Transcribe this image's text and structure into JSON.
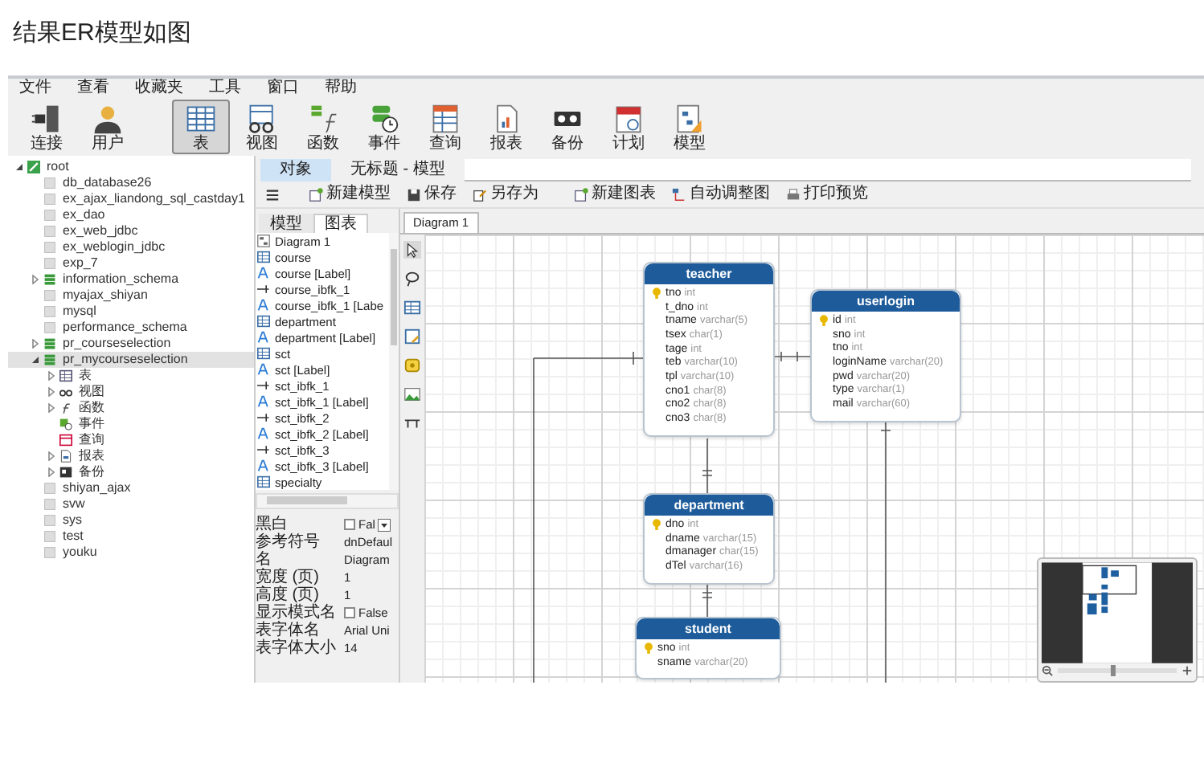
{
  "heading": "结果ER模型如图",
  "menu": [
    "文件",
    "查看",
    "收藏夹",
    "工具",
    "窗口",
    "帮助"
  ],
  "toolbar": [
    {
      "label": "连接",
      "kind": "plug",
      "selected": false
    },
    {
      "label": "用户",
      "kind": "user",
      "selected": false
    },
    {
      "label": "表",
      "kind": "table",
      "selected": true
    },
    {
      "label": "视图",
      "kind": "view",
      "selected": false
    },
    {
      "label": "函数",
      "kind": "function",
      "selected": false
    },
    {
      "label": "事件",
      "kind": "event",
      "selected": false
    },
    {
      "label": "查询",
      "kind": "query",
      "selected": false
    },
    {
      "label": "报表",
      "kind": "report",
      "selected": false
    },
    {
      "label": "备份",
      "kind": "backup",
      "selected": false
    },
    {
      "label": "计划",
      "kind": "schedule",
      "selected": false
    },
    {
      "label": "模型",
      "kind": "model",
      "selected": false
    }
  ],
  "tree": [
    {
      "label": "root",
      "kind": "connection",
      "expanded": true,
      "selected": false,
      "children": [
        {
          "label": "db_database26",
          "kind": "db",
          "selected": false
        },
        {
          "label": "ex_ajax_liandong_sql_castday1",
          "kind": "db",
          "selected": false
        },
        {
          "label": "ex_dao",
          "kind": "db",
          "selected": false
        },
        {
          "label": "ex_web_jdbc",
          "kind": "db",
          "selected": false
        },
        {
          "label": "ex_weblogin_jdbc",
          "kind": "db",
          "selected": false
        },
        {
          "label": "exp_7",
          "kind": "db",
          "selected": false
        },
        {
          "label": "information_schema",
          "kind": "db-open",
          "expanded": false,
          "selected": false
        },
        {
          "label": "myajax_shiyan",
          "kind": "db",
          "selected": false
        },
        {
          "label": "mysql",
          "kind": "db",
          "selected": false
        },
        {
          "label": "performance_schema",
          "kind": "db",
          "selected": false
        },
        {
          "label": "pr_courseselection",
          "kind": "db-open",
          "expanded": false,
          "selected": false
        },
        {
          "label": "pr_mycourseselection",
          "kind": "db-open",
          "expanded": true,
          "selected": true,
          "children": [
            {
              "label": "表",
              "kind": "table",
              "expanded": false,
              "selected": false
            },
            {
              "label": "视图",
              "kind": "view",
              "expanded": false,
              "selected": false
            },
            {
              "label": "函数",
              "kind": "function",
              "expanded": false,
              "selected": false
            },
            {
              "label": "事件",
              "kind": "event",
              "selected": false
            },
            {
              "label": "查询",
              "kind": "query",
              "selected": false
            },
            {
              "label": "报表",
              "kind": "report",
              "expanded": false,
              "selected": false
            },
            {
              "label": "备份",
              "kind": "backup",
              "expanded": false,
              "selected": false
            }
          ]
        },
        {
          "label": "shiyan_ajax",
          "kind": "db",
          "selected": false
        },
        {
          "label": "svw",
          "kind": "db",
          "selected": false
        },
        {
          "label": "sys",
          "kind": "db",
          "selected": false
        },
        {
          "label": "test",
          "kind": "db",
          "selected": false
        },
        {
          "label": "youku",
          "kind": "db",
          "selected": false
        }
      ]
    }
  ],
  "doc_tabs": [
    {
      "label": "对象",
      "selected": true
    },
    {
      "label": "无标题 - 模型",
      "selected": false
    }
  ],
  "model_toolbar": [
    {
      "label": "新建模型",
      "kind": "new"
    },
    {
      "label": "保存",
      "kind": "save"
    },
    {
      "label": "另存为",
      "kind": "saveas"
    },
    {
      "label": "新建图表",
      "kind": "new"
    },
    {
      "label": "自动调整图",
      "kind": "layout"
    },
    {
      "label": "打印预览",
      "kind": "print"
    }
  ],
  "panel_tabs": [
    {
      "label": "模型",
      "selected": false
    },
    {
      "label": "图表",
      "selected": true
    }
  ],
  "objects": [
    {
      "label": "Diagram 1",
      "kind": "diagram"
    },
    {
      "label": "course",
      "kind": "table"
    },
    {
      "label": "course [Label]",
      "kind": "label"
    },
    {
      "label": "course_ibfk_1",
      "kind": "relation"
    },
    {
      "label": "course_ibfk_1 [Labe",
      "kind": "label"
    },
    {
      "label": "department",
      "kind": "table"
    },
    {
      "label": "department [Label]",
      "kind": "label"
    },
    {
      "label": "sct",
      "kind": "table"
    },
    {
      "label": "sct [Label]",
      "kind": "label"
    },
    {
      "label": "sct_ibfk_1",
      "kind": "relation"
    },
    {
      "label": "sct_ibfk_1 [Label]",
      "kind": "label"
    },
    {
      "label": "sct_ibfk_2",
      "kind": "relation"
    },
    {
      "label": "sct_ibfk_2 [Label]",
      "kind": "label"
    },
    {
      "label": "sct_ibfk_3",
      "kind": "relation"
    },
    {
      "label": "sct_ibfk_3 [Label]",
      "kind": "label"
    },
    {
      "label": "specialty",
      "kind": "table"
    }
  ],
  "properties": [
    {
      "name": "黑白",
      "value": "Fal",
      "kind": "checkbox",
      "checked": false,
      "dropdown": true
    },
    {
      "name": "参考符号",
      "value": "dnDefaul",
      "kind": "text"
    },
    {
      "name": "名",
      "value": "Diagram",
      "kind": "text"
    },
    {
      "name": "宽度 (页)",
      "value": "1",
      "kind": "text"
    },
    {
      "name": "高度 (页)",
      "value": "1",
      "kind": "text"
    },
    {
      "name": "显示模式名",
      "value": "False",
      "kind": "checkbox",
      "checked": false
    },
    {
      "name": "表字体名",
      "value": "Arial Uni",
      "kind": "text"
    },
    {
      "name": "表字体大小",
      "value": "14",
      "kind": "text"
    }
  ],
  "diagram_tab": "Diagram 1",
  "zoom": {
    "level": 0.45
  },
  "entities": [
    {
      "name": "teacher",
      "fields": [
        {
          "name": "tno",
          "type": "int",
          "key": true
        },
        {
          "name": "t_dno",
          "type": "int",
          "key": false
        },
        {
          "name": "tname",
          "type": "varchar(5)",
          "key": false
        },
        {
          "name": "tsex",
          "type": "char(1)",
          "key": false
        },
        {
          "name": "tage",
          "type": "int",
          "key": false
        },
        {
          "name": "teb",
          "type": "varchar(10)",
          "key": false
        },
        {
          "name": "tpl",
          "type": "varchar(10)",
          "key": false
        },
        {
          "name": "cno1",
          "type": "char(8)",
          "key": false
        },
        {
          "name": "cno2",
          "type": "char(8)",
          "key": false
        },
        {
          "name": "cno3",
          "type": "char(8)",
          "key": false
        }
      ]
    },
    {
      "name": "userlogin",
      "fields": [
        {
          "name": "id",
          "type": "int",
          "key": true
        },
        {
          "name": "sno",
          "type": "int",
          "key": false
        },
        {
          "name": "tno",
          "type": "int",
          "key": false
        },
        {
          "name": "loginName",
          "type": "varchar(20)",
          "key": false
        },
        {
          "name": "pwd",
          "type": "varchar(20)",
          "key": false
        },
        {
          "name": "type",
          "type": "varchar(1)",
          "key": false
        },
        {
          "name": "mail",
          "type": "varchar(60)",
          "key": false
        }
      ]
    },
    {
      "name": "department",
      "fields": [
        {
          "name": "dno",
          "type": "int",
          "key": true
        },
        {
          "name": "dname",
          "type": "varchar(15)",
          "key": false
        },
        {
          "name": "dmanager",
          "type": "char(15)",
          "key": false
        },
        {
          "name": "dTel",
          "type": "varchar(16)",
          "key": false
        }
      ]
    },
    {
      "name": "student",
      "fields": [
        {
          "name": "sno",
          "type": "int",
          "key": true
        },
        {
          "name": "sname",
          "type": "varchar(20)",
          "key": false
        }
      ]
    }
  ]
}
